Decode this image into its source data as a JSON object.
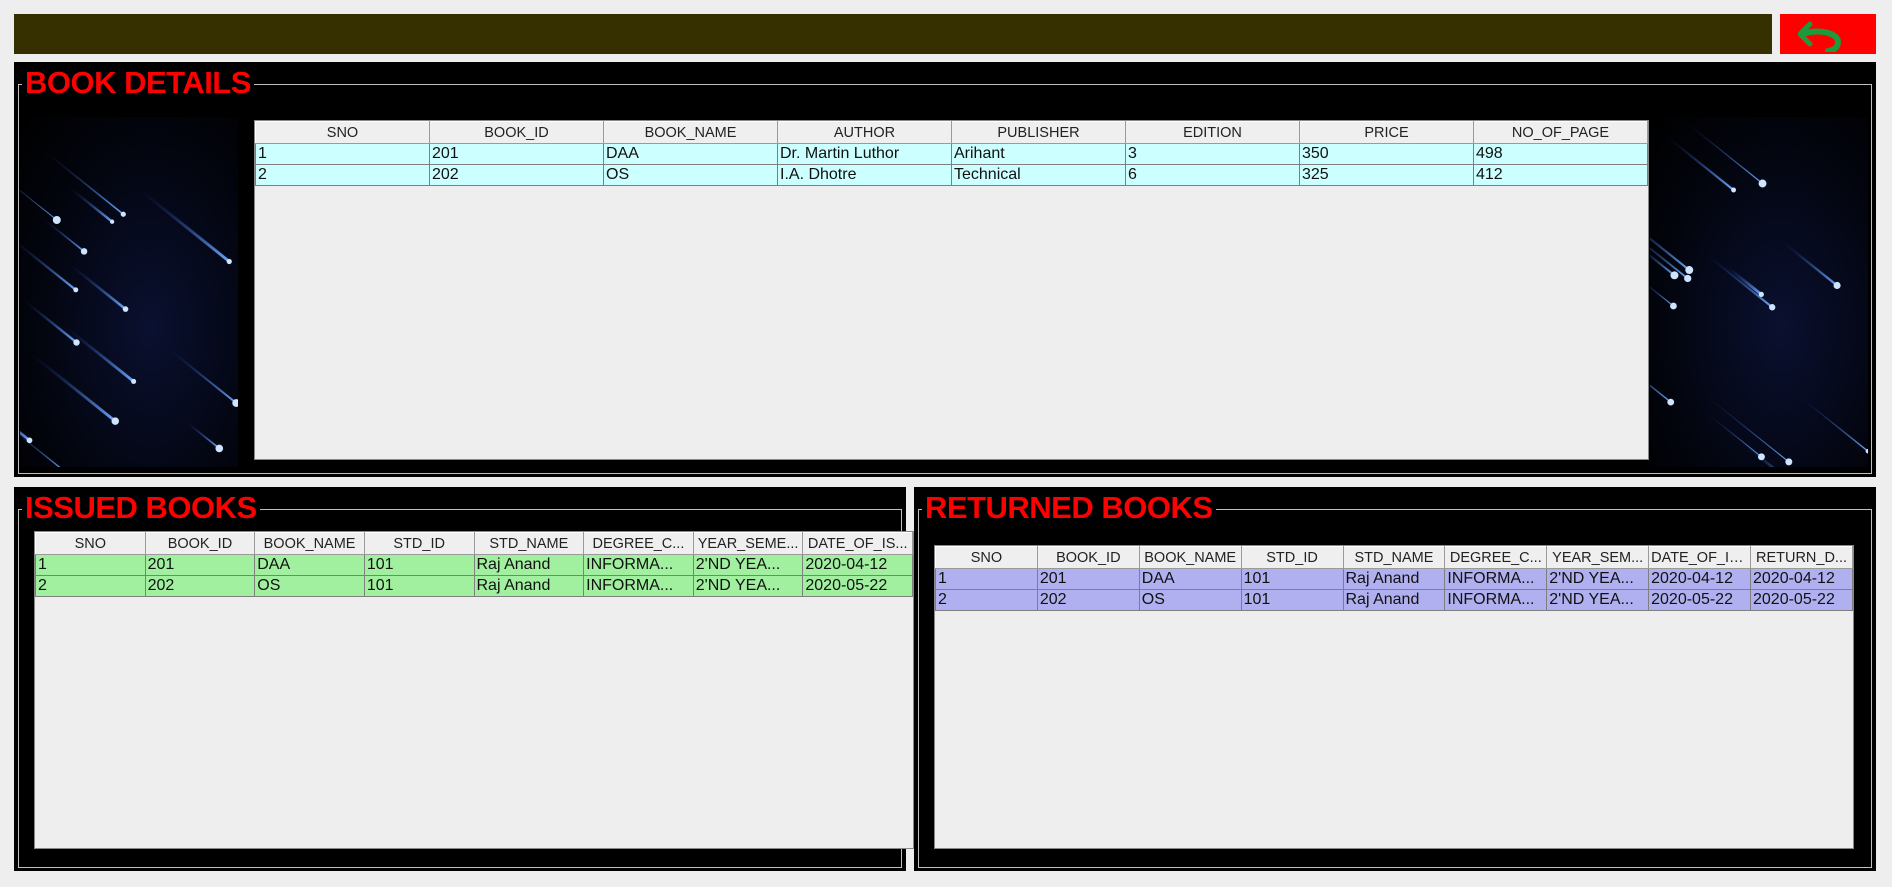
{
  "colors": {
    "accent": "#ff0000",
    "topbar": "#363000",
    "books_row": "#ccffff",
    "issued_row": "#a0f0a0",
    "returned_row": "#b0b0f0"
  },
  "toolbar": {
    "back_icon": "back-arrow-icon"
  },
  "book_details": {
    "title": "BOOK DETAILS",
    "columns": [
      "SNO",
      "BOOK_ID",
      "BOOK_NAME",
      "AUTHOR",
      "PUBLISHER",
      "EDITION",
      "PRICE",
      "NO_OF_PAGE"
    ],
    "rows": [
      [
        "1",
        "201",
        "DAA",
        "Dr. Martin Luthor",
        "Arihant",
        "3",
        "350",
        "498"
      ],
      [
        "2",
        "202",
        "OS",
        "I.A. Dhotre",
        "Technical",
        "6",
        "325",
        "412"
      ]
    ]
  },
  "issued_books": {
    "title": "ISSUED BOOKS",
    "columns": [
      "SNO",
      "BOOK_ID",
      "BOOK_NAME",
      "STD_ID",
      "STD_NAME",
      "DEGREE_C...",
      "YEAR_SEME...",
      "DATE_OF_IS..."
    ],
    "rows": [
      [
        "1",
        "201",
        "DAA",
        "101",
        "Raj Anand",
        "INFORMA...",
        "2'ND YEA...",
        "2020-04-12"
      ],
      [
        "2",
        "202",
        "OS",
        "101",
        "Raj Anand",
        "INFORMA...",
        "2'ND YEA...",
        "2020-05-22"
      ]
    ]
  },
  "returned_books": {
    "title": "RETURNED BOOKS",
    "columns": [
      "SNO",
      "BOOK_ID",
      "BOOK_NAME",
      "STD_ID",
      "STD_NAME",
      "DEGREE_C...",
      "YEAR_SEM...",
      "DATE_OF_IS...",
      "RETURN_D..."
    ],
    "rows": [
      [
        "1",
        "201",
        "DAA",
        "101",
        "Raj Anand",
        "INFORMA...",
        "2'ND YEA...",
        "2020-04-12",
        "2020-04-12"
      ],
      [
        "2",
        "202",
        "OS",
        "101",
        "Raj Anand",
        "INFORMA...",
        "2'ND YEA...",
        "2020-05-22",
        "2020-05-22"
      ]
    ]
  }
}
